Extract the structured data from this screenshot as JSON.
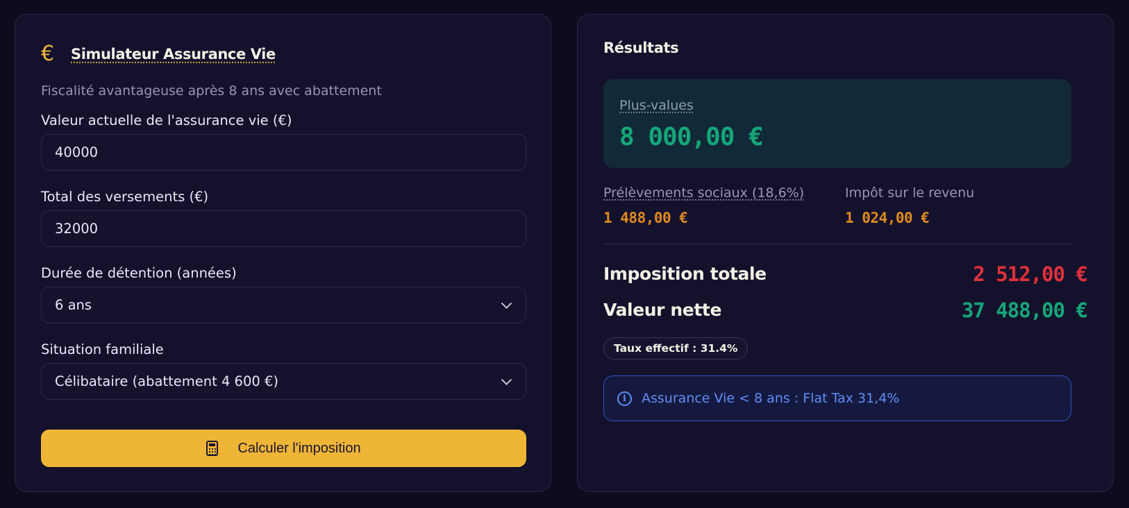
{
  "simulator": {
    "title": "Simulateur Assurance Vie",
    "subtitle": "Fiscalité avantageuse après 8 ans avec abattement",
    "icon": "euro-icon",
    "accent_color": "#efb537",
    "fields": {
      "current_value": {
        "label": "Valeur actuelle de l'assurance vie (€)",
        "value": "40000"
      },
      "total_payments": {
        "label": "Total des versements (€)",
        "value": "32000"
      },
      "holding_duration": {
        "label": "Durée de détention (années)",
        "value": "6 ans"
      },
      "family_situation": {
        "label": "Situation familiale",
        "value": "Célibataire (abattement 4 600 €)"
      }
    },
    "calculate_button": {
      "label": "Calculer l'imposition",
      "icon": "calculator-icon"
    }
  },
  "results": {
    "title": "Résultats",
    "gains": {
      "label": "Plus-values",
      "value": "8 000,00 €",
      "color": "#16a678"
    },
    "social_charges": {
      "label": "Prélèvements sociaux (18,6%)",
      "value": "1 488,00 €",
      "color": "#e08a1e"
    },
    "income_tax": {
      "label": "Impôt sur le revenu",
      "value": "1 024,00 €",
      "color": "#e08a1e"
    },
    "total_tax": {
      "label": "Imposition totale",
      "value": "2 512,00 €",
      "color": "#e0313b"
    },
    "net_value": {
      "label": "Valeur nette",
      "value": "37 488,00 €",
      "color": "#16a678"
    },
    "effective_rate": "Taux effectif : 31.4%",
    "info": {
      "text": "Assurance Vie < 8 ans : Flat Tax 31,4%",
      "icon": "info-icon",
      "color": "#5d8ff5"
    }
  }
}
